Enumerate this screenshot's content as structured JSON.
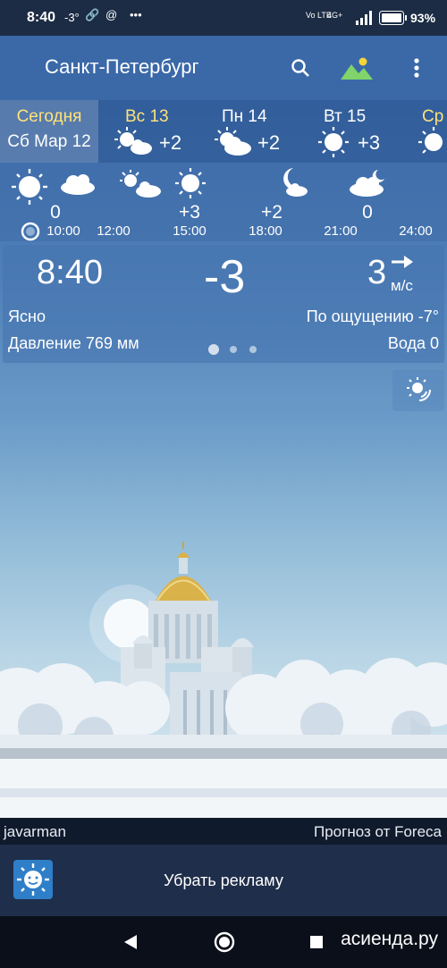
{
  "status": {
    "time": "8:40",
    "temp": "-3°",
    "battery": "93%",
    "network": "4G+"
  },
  "appbar": {
    "city": "Санкт-Петербург"
  },
  "days": [
    {
      "name": "Сегодня",
      "sub": "Сб Мар 12",
      "temp": "",
      "selected": true
    },
    {
      "name": "Вс 13",
      "temp": "+2"
    },
    {
      "name": "Пн 14",
      "temp": "+2"
    },
    {
      "name": "Вт 15",
      "temp": "+3"
    },
    {
      "name": "Ср",
      "temp": ""
    }
  ],
  "hourly": {
    "temps": [
      "0",
      "+3",
      "+2",
      "0"
    ],
    "times": [
      "10:00",
      "12:00",
      "15:00",
      "18:00",
      "21:00",
      "24:00"
    ]
  },
  "current": {
    "time": "8:40",
    "temp": "-3",
    "wind_speed": "3",
    "wind_unit": "м/с",
    "condition": "Ясно",
    "feels_like": "По ощущению -7°",
    "pressure": "Давление 769 мм",
    "water": "Вода 0"
  },
  "credits": {
    "photo": "javarman",
    "provider": "Прогноз от Foreca"
  },
  "ad": {
    "remove_label": "Убрать рекламу"
  },
  "watermark": "асиенда.ру",
  "colors": {
    "appbar": "#3b69a8",
    "accent_day": "#ffe27a"
  }
}
